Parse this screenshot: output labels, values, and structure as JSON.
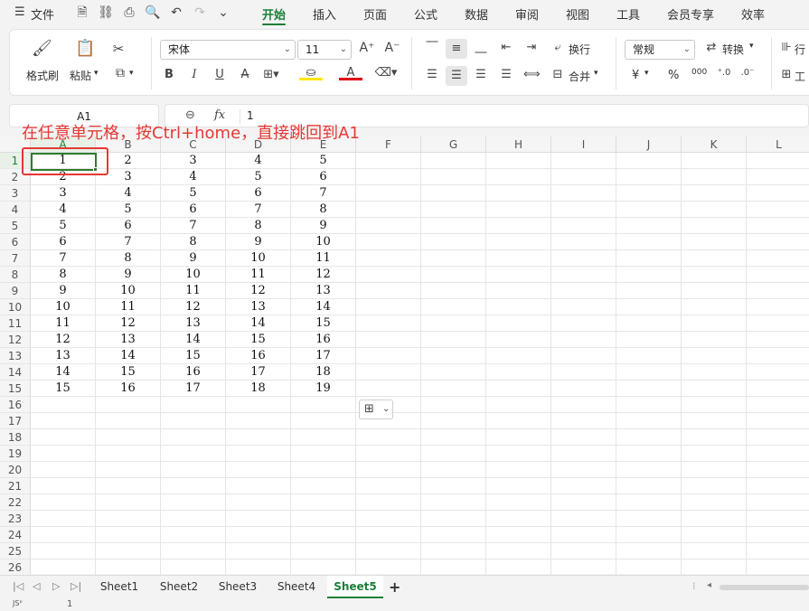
{
  "menu": {
    "file_icon": "hamburger-icon",
    "file_label": "文件",
    "tabs": [
      "开始",
      "插入",
      "页面",
      "公式",
      "数据",
      "审阅",
      "视图",
      "工具",
      "会员专享",
      "效率"
    ],
    "active_tab": 0
  },
  "ribbon": {
    "format_painter": "格式刷",
    "paste": "粘贴",
    "font_name": "宋体",
    "font_size": "11",
    "wrap_text": "换行",
    "number_format": "常规",
    "convert": "转换",
    "merge": "合并",
    "currency_symbol": "¥",
    "percent_symbol": "%",
    "thousands_symbol": "000",
    "partial_labels": [
      "行",
      "工"
    ]
  },
  "formula_bar": {
    "name_box": "A1",
    "fx_label": "fx",
    "value": "1"
  },
  "columns": [
    "A",
    "B",
    "C",
    "D",
    "E",
    "F",
    "G",
    "H",
    "I",
    "J",
    "K",
    "L"
  ],
  "rows": [
    "1",
    "2",
    "3",
    "4",
    "5",
    "6",
    "7",
    "8",
    "9",
    "10",
    "11",
    "12",
    "13",
    "14",
    "15",
    "16",
    "17",
    "18",
    "19",
    "20",
    "21",
    "22",
    "23",
    "24",
    "25",
    "26"
  ],
  "cells": [
    [
      "1",
      "2",
      "3",
      "4",
      "5"
    ],
    [
      "2",
      "3",
      "4",
      "5",
      "6"
    ],
    [
      "3",
      "4",
      "5",
      "6",
      "7"
    ],
    [
      "4",
      "5",
      "6",
      "7",
      "8"
    ],
    [
      "5",
      "6",
      "7",
      "8",
      "9"
    ],
    [
      "6",
      "7",
      "8",
      "9",
      "10"
    ],
    [
      "7",
      "8",
      "9",
      "10",
      "11"
    ],
    [
      "8",
      "9",
      "10",
      "11",
      "12"
    ],
    [
      "9",
      "10",
      "11",
      "12",
      "13"
    ],
    [
      "10",
      "11",
      "12",
      "13",
      "14"
    ],
    [
      "11",
      "12",
      "13",
      "14",
      "15"
    ],
    [
      "12",
      "13",
      "14",
      "15",
      "16"
    ],
    [
      "13",
      "14",
      "15",
      "16",
      "17"
    ],
    [
      "14",
      "15",
      "16",
      "17",
      "18"
    ],
    [
      "15",
      "16",
      "17",
      "18",
      "19"
    ]
  ],
  "annotation": "在任意单元格，按Ctrl+home，直接跳回到A1",
  "sheets": [
    "Sheet1",
    "Sheet2",
    "Sheet3",
    "Sheet4",
    "Sheet5"
  ],
  "active_sheet": 4,
  "add_sheet": "+",
  "status_left": "1",
  "colors": {
    "accent": "#1a7f37",
    "annotation": "#e53935",
    "selection": "#2e7d32"
  }
}
